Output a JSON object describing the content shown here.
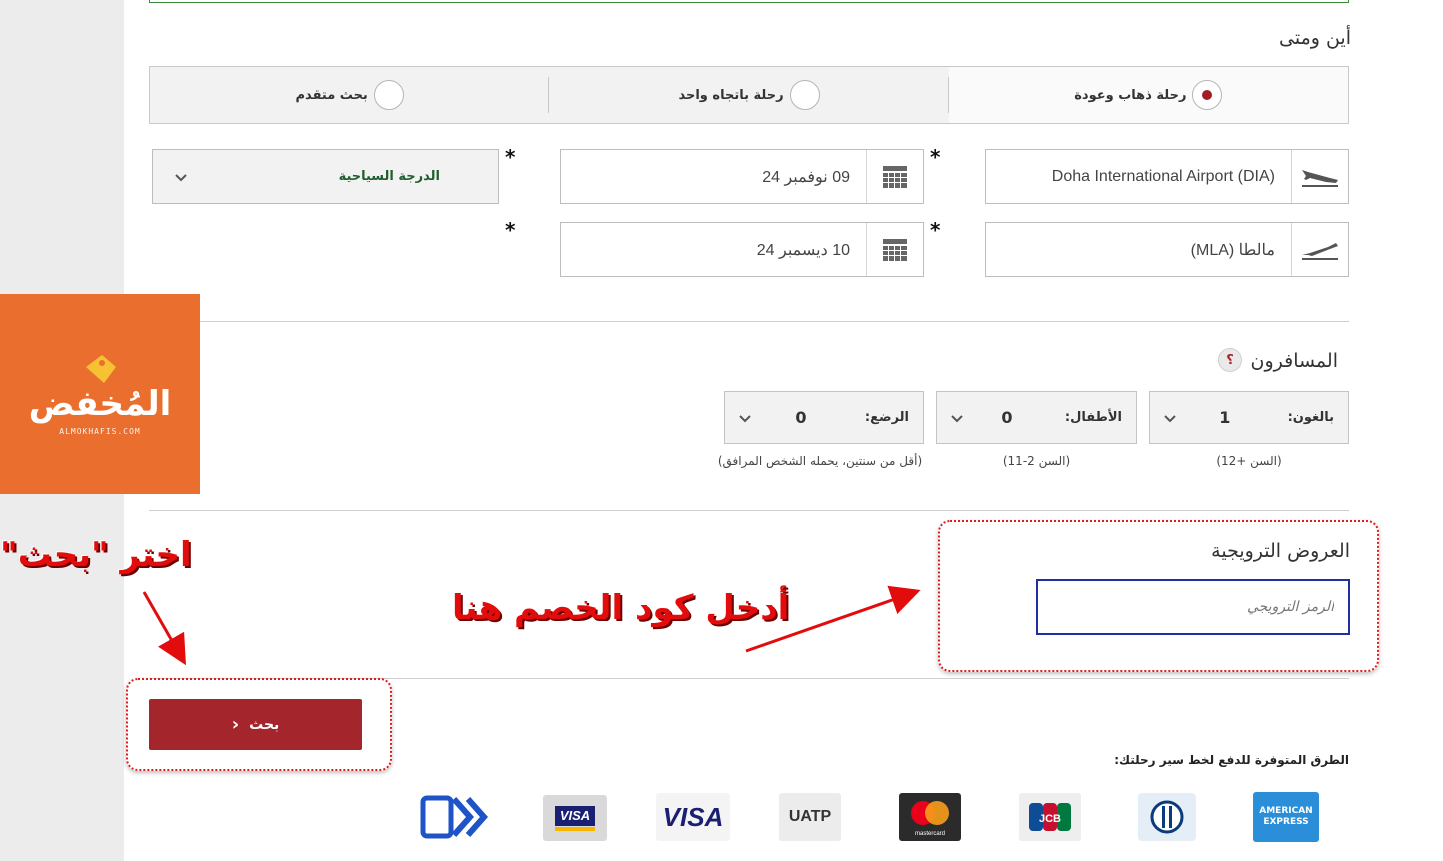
{
  "where_when": {
    "title": "أين ومتى",
    "trip_types": [
      {
        "label": "رحلة ذهاب وعودة",
        "selected": true
      },
      {
        "label": "رحلة باتجاه واحد",
        "selected": false
      },
      {
        "label": "بحث متقدم",
        "selected": false
      }
    ],
    "origin": "Doha International Airport (DIA)",
    "destination": "مالطا (MLA)",
    "depart_date": "09 نوفمبر 24",
    "return_date": "10 ديسمبر 24",
    "cabin_class": "الدرجة السياحية",
    "required_mark": "*"
  },
  "passengers": {
    "title": "المسافرون",
    "help_icon_text": "؟",
    "adults": {
      "label": "بالغون:",
      "value": "1",
      "note": "(السن +12)"
    },
    "children": {
      "label": "الأطفال:",
      "value": "0",
      "note": "(السن 2-11)"
    },
    "infants": {
      "label": "الرضع:",
      "value": "0",
      "note": "(أقل من سنتين، يحمله الشخص المرافق)"
    }
  },
  "promo": {
    "title": "العروض الترويجية",
    "placeholder": "الرمز الترويجي"
  },
  "search_button": {
    "label": "بحث"
  },
  "payment": {
    "title": "الطرق المتوفرة للدفع لخط سير رحلتك:",
    "methods": [
      "AMERICAN EXPRESS",
      "Diners Club",
      "JCB",
      "mastercard",
      "UATP",
      "VISA",
      "VISA Electron",
      "Fawry"
    ]
  },
  "annotations": {
    "choose_search": "اختر \"بحث\"",
    "enter_code": "أدخل كود الخصم هنا"
  },
  "watermark": {
    "brand": "المُخفض",
    "sub": "ALMOKHAFIS.COM"
  },
  "colors": {
    "accent": "#a4262c",
    "highlight": "#e30c0c",
    "logo_bg": "#ea6f2f",
    "cabin_text": "#1f5e2e"
  }
}
